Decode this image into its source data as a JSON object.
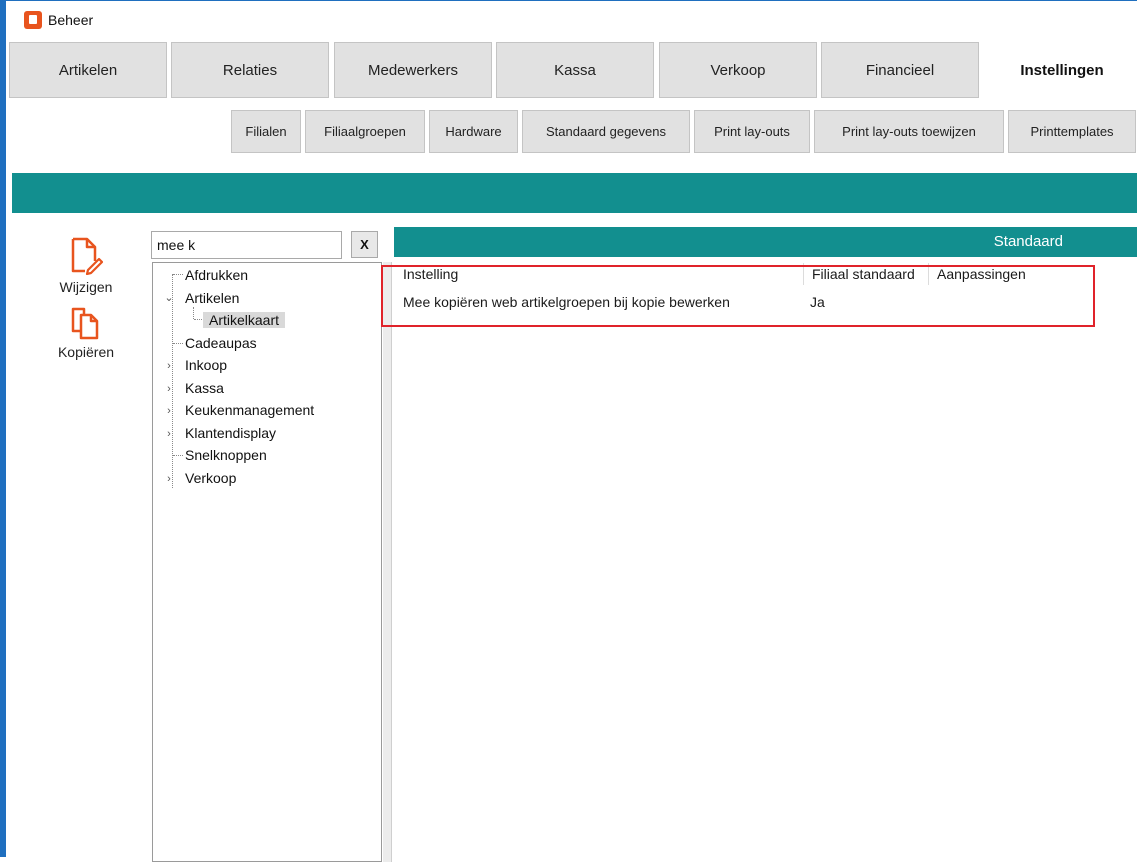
{
  "window": {
    "title": "Beheer"
  },
  "main_tabs": [
    {
      "label": "Artikelen"
    },
    {
      "label": "Relaties"
    },
    {
      "label": "Medewerkers"
    },
    {
      "label": "Kassa"
    },
    {
      "label": "Verkoop"
    },
    {
      "label": "Financieel"
    },
    {
      "label": "Instellingen",
      "active": true
    }
  ],
  "sub_tabs": [
    {
      "label": "Filialen"
    },
    {
      "label": "Filiaalgroepen"
    },
    {
      "label": "Hardware"
    },
    {
      "label": "Standaard gegevens"
    },
    {
      "label": "Print lay-outs"
    },
    {
      "label": "Print lay-outs toewijzen"
    },
    {
      "label": "Printtemplates"
    }
  ],
  "actions": {
    "edit_label": "Wijzigen",
    "copy_label": "Kopiëren"
  },
  "search": {
    "value": "mee k",
    "clear_label": "X"
  },
  "tree": {
    "items": [
      {
        "label": "Afdrukken"
      },
      {
        "label": "Artikelen",
        "expanded": true
      },
      {
        "label": "Artikelkaart",
        "selected": true
      },
      {
        "label": "Cadeaupas"
      },
      {
        "label": "Inkoop"
      },
      {
        "label": "Kassa"
      },
      {
        "label": "Keukenmanagement"
      },
      {
        "label": "Klantendisplay"
      },
      {
        "label": "Snelknoppen"
      },
      {
        "label": "Verkoop"
      }
    ]
  },
  "panel": {
    "header": "Standaard",
    "columns": {
      "setting": "Instelling",
      "branch_default": "Filiaal standaard",
      "adjustments": "Aanpassingen"
    },
    "rows": [
      {
        "setting": "Mee kopiëren web artikelgroepen bij kopie bewerken",
        "branch_default": "Ja",
        "adjustments": ""
      }
    ]
  },
  "colors": {
    "accent": "#128f8f",
    "icon": "#e8541e",
    "highlight": "#e0232a"
  }
}
